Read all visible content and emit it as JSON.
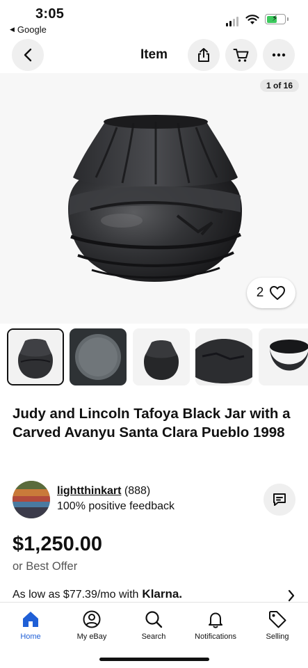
{
  "status_bar": {
    "time": "3:05",
    "back_app": "Google"
  },
  "header": {
    "title": "Item"
  },
  "gallery": {
    "counter": "1 of 16",
    "like_count": "2"
  },
  "item": {
    "title": "Judy and Lincoln Tafoya Black Jar with a Carved Avanyu Santa Clara Pueblo 1998"
  },
  "seller": {
    "name": "lightthinkart",
    "rating_count": "(888)",
    "feedback": "100% positive feedback"
  },
  "pricing": {
    "price": "$1,250.00",
    "offer": "or Best Offer",
    "financing_text": "As low as $77.39/mo with",
    "financing_brand": "Klarna."
  },
  "tabbar": {
    "tabs": [
      {
        "label": "Home",
        "icon": "home-icon",
        "active": true
      },
      {
        "label": "My eBay",
        "icon": "user-icon",
        "active": false
      },
      {
        "label": "Search",
        "icon": "search-icon",
        "active": false
      },
      {
        "label": "Notifications",
        "icon": "bell-icon",
        "active": false
      },
      {
        "label": "Selling",
        "icon": "tag-icon",
        "active": false
      }
    ]
  },
  "colors": {
    "accent": "#1f5fd6",
    "battery": "#3cc95d"
  }
}
